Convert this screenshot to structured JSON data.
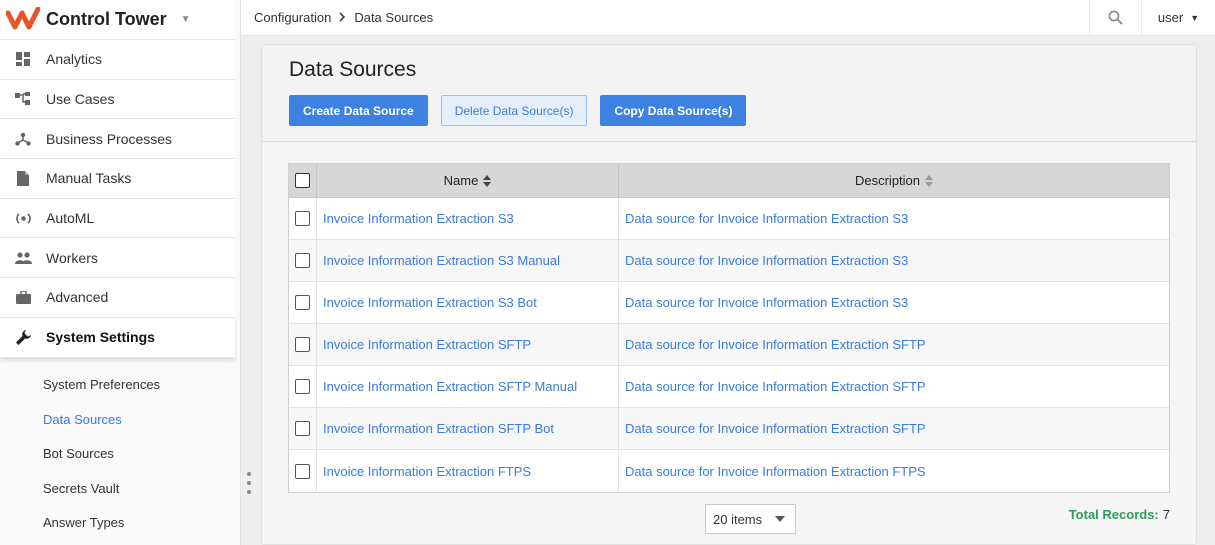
{
  "app": {
    "title": "Control Tower"
  },
  "colors": {
    "accent": "#3d82e0",
    "link": "#3b7bd8",
    "brand": "#e8542a",
    "total_label": "#2e9e5b"
  },
  "sidebar": {
    "items": [
      {
        "label": "Analytics",
        "icon": "dashboard-icon"
      },
      {
        "label": "Use Cases",
        "icon": "hierarchy-icon"
      },
      {
        "label": "Business Processes",
        "icon": "flow-icon"
      },
      {
        "label": "Manual Tasks",
        "icon": "document-icon"
      },
      {
        "label": "AutoML",
        "icon": "automl-icon"
      },
      {
        "label": "Workers",
        "icon": "people-icon"
      },
      {
        "label": "Advanced",
        "icon": "briefcase-icon"
      },
      {
        "label": "System Settings",
        "icon": "wrench-icon"
      }
    ],
    "sub_items": [
      {
        "label": "System Preferences"
      },
      {
        "label": "Data Sources"
      },
      {
        "label": "Bot Sources"
      },
      {
        "label": "Secrets Vault"
      },
      {
        "label": "Answer Types"
      }
    ]
  },
  "header": {
    "breadcrumb": [
      "Configuration",
      "Data Sources"
    ],
    "user": "user"
  },
  "main": {
    "title": "Data Sources",
    "buttons": {
      "create": "Create Data Source",
      "delete": "Delete Data Source(s)",
      "copy": "Copy Data Source(s)"
    },
    "table": {
      "columns": {
        "name": "Name",
        "description": "Description"
      },
      "rows": [
        {
          "name": "Invoice Information Extraction S3",
          "description": "Data source for Invoice Information Extraction S3"
        },
        {
          "name": "Invoice Information Extraction S3 Manual",
          "description": "Data source for Invoice Information Extraction S3"
        },
        {
          "name": "Invoice Information Extraction S3 Bot",
          "description": "Data source for Invoice Information Extraction S3"
        },
        {
          "name": "Invoice Information Extraction SFTP",
          "description": "Data source for Invoice Information Extraction SFTP"
        },
        {
          "name": "Invoice Information Extraction SFTP Manual",
          "description": "Data source for Invoice Information Extraction SFTP"
        },
        {
          "name": "Invoice Information Extraction SFTP Bot",
          "description": "Data source for Invoice Information Extraction SFTP"
        },
        {
          "name": "Invoice Information Extraction FTPS",
          "description": "Data source for Invoice Information Extraction FTPS"
        }
      ]
    },
    "pager": {
      "selected": "20 items"
    },
    "total": {
      "label": "Total Records:",
      "value": "7"
    }
  }
}
